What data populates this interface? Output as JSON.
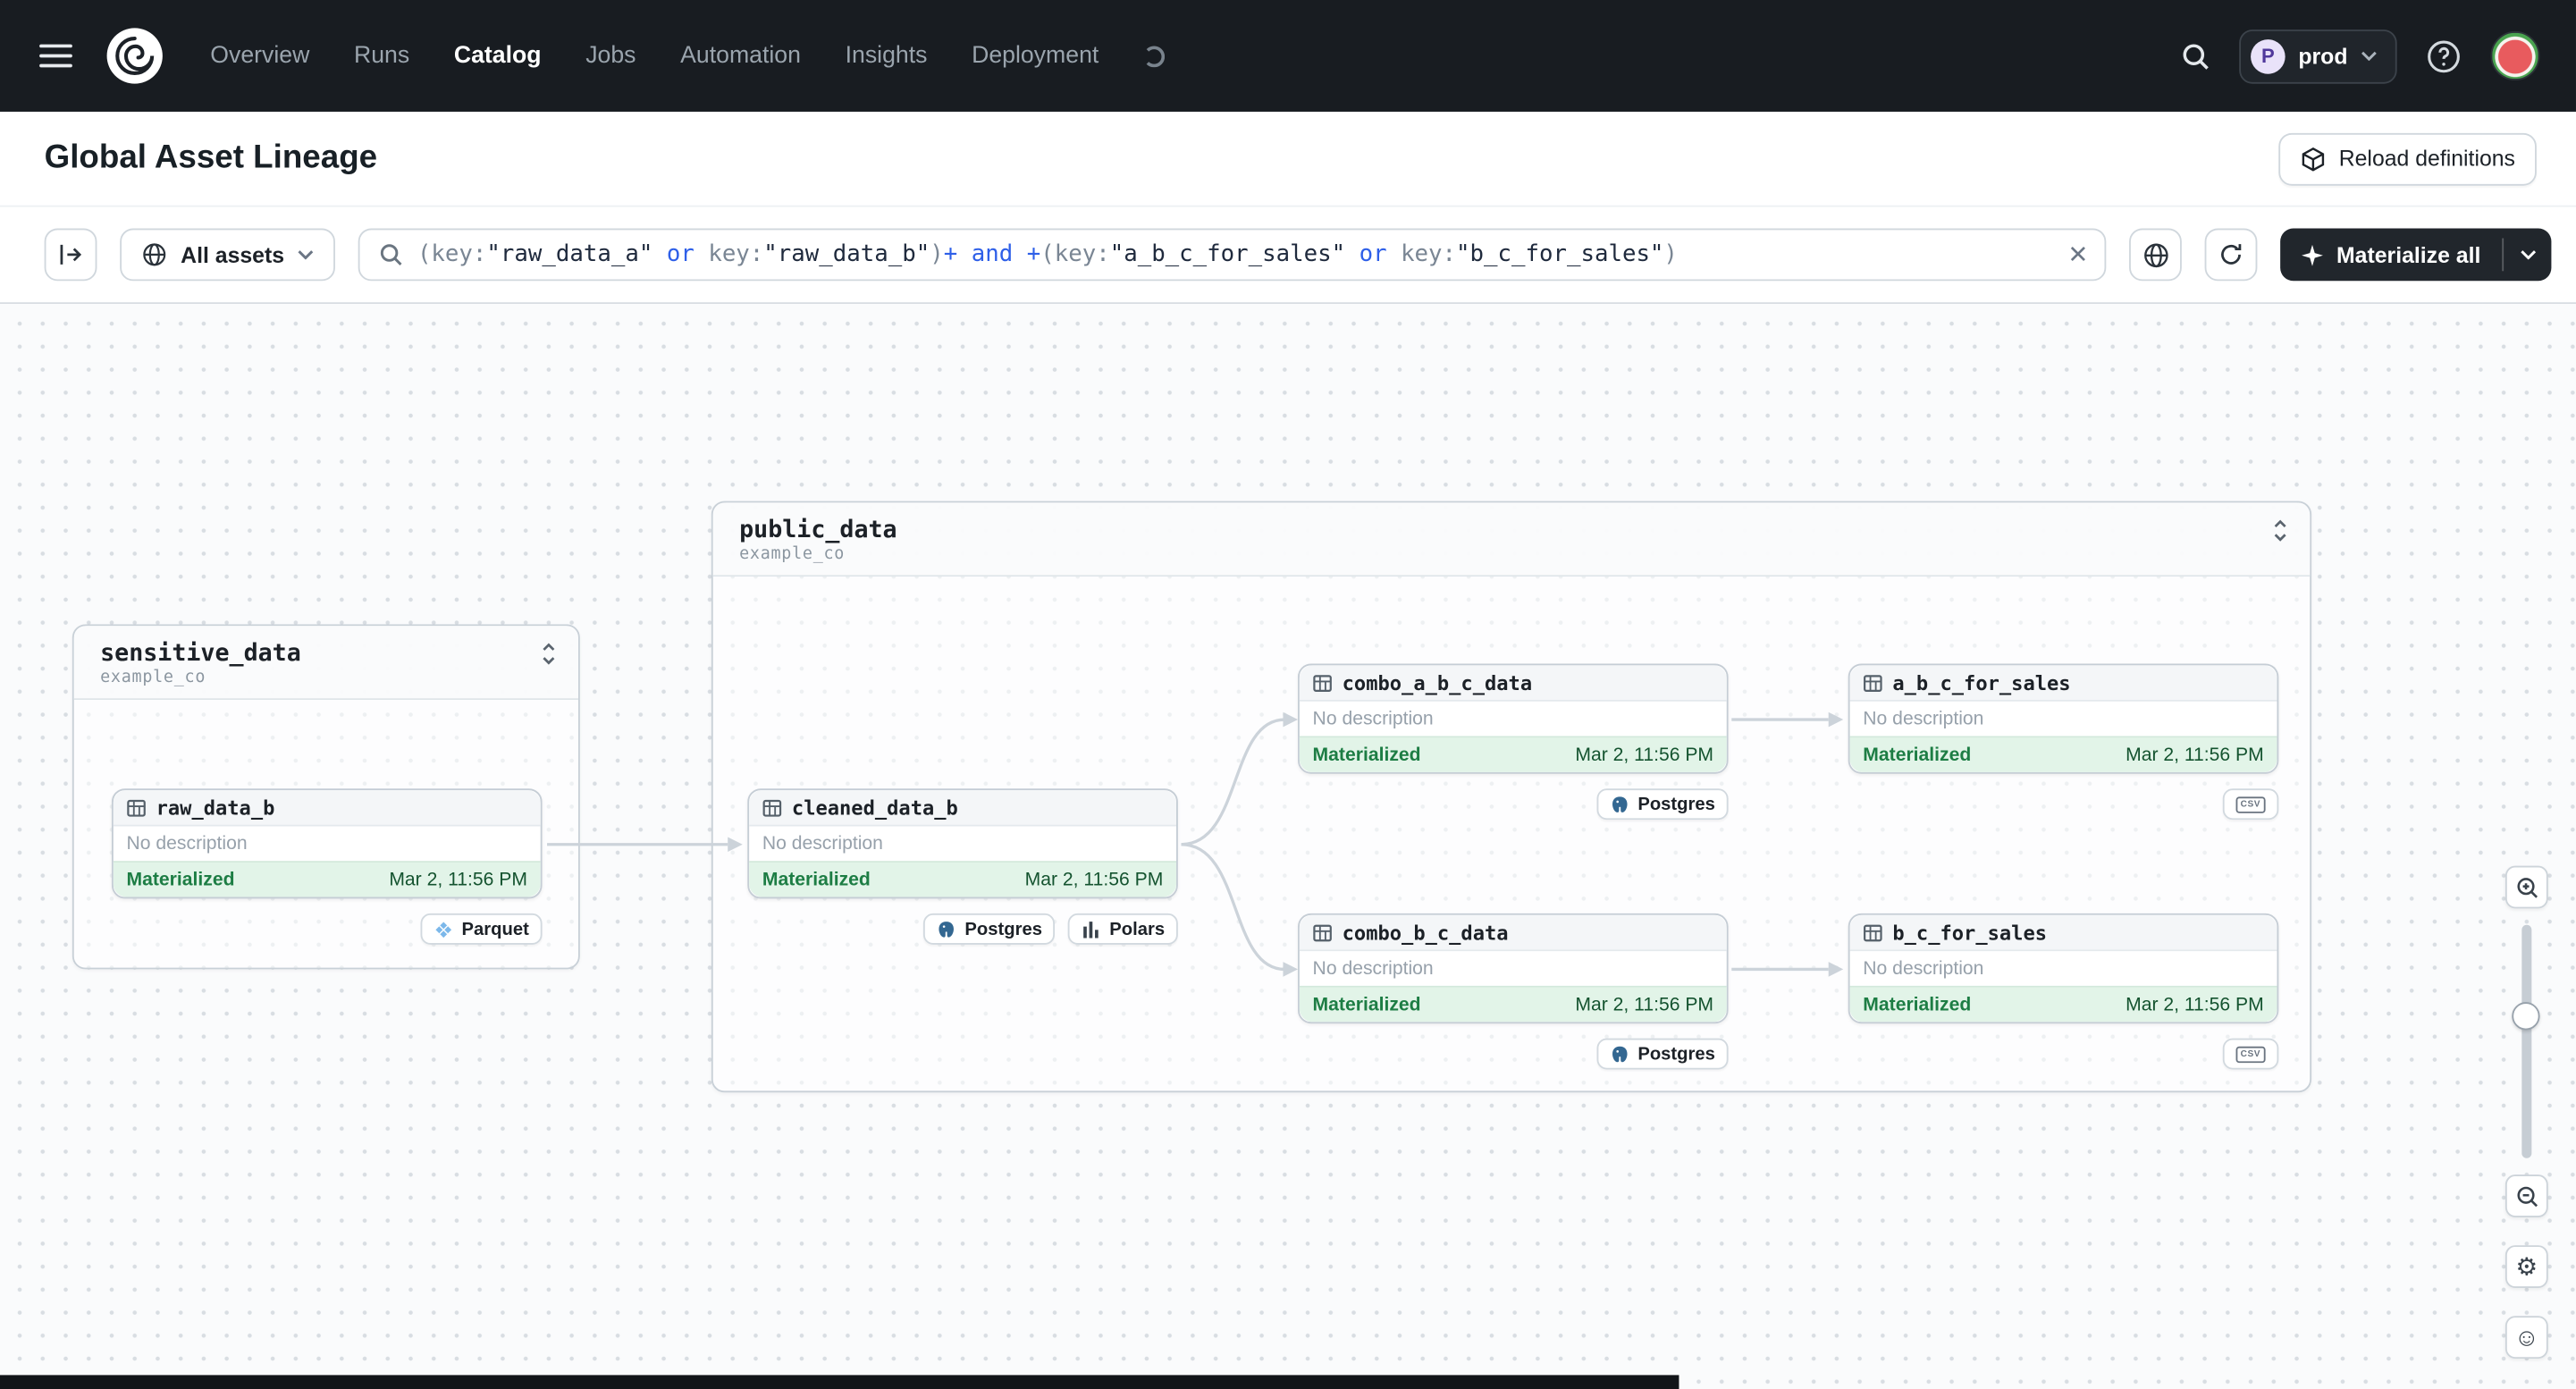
{
  "nav": {
    "items": [
      {
        "label": "Overview"
      },
      {
        "label": "Runs"
      },
      {
        "label": "Catalog"
      },
      {
        "label": "Jobs"
      },
      {
        "label": "Automation"
      },
      {
        "label": "Insights"
      },
      {
        "label": "Deployment"
      }
    ],
    "active_item": "Catalog",
    "deployment": {
      "initial": "P",
      "name": "prod"
    }
  },
  "header": {
    "title": "Global Asset Lineage",
    "reload_button": "Reload definitions"
  },
  "toolbar": {
    "scope_label": "All assets",
    "materialize_label": "Materialize all",
    "search": {
      "segments": [
        {
          "t": "(key:"
        },
        {
          "t": "\"raw_data_a\""
        },
        {
          "t": " or "
        },
        {
          "t": "key:"
        },
        {
          "t": "\"raw_data_b\""
        },
        {
          "t": ")"
        },
        {
          "t": "+"
        },
        {
          "t": " and "
        },
        {
          "t": "+"
        },
        {
          "t": "(key:"
        },
        {
          "t": "\"a_b_c_for_sales\""
        },
        {
          "t": " or "
        },
        {
          "t": "key:"
        },
        {
          "t": "\"b_c_for_sales\""
        },
        {
          "t": ")"
        }
      ]
    }
  },
  "graph": {
    "groups": [
      {
        "name": "sensitive_data",
        "repo": "example_co"
      },
      {
        "name": "public_data",
        "repo": "example_co"
      }
    ],
    "nodes": [
      {
        "name": "raw_data_b",
        "description": "No description",
        "status": "Materialized",
        "timestamp": "Mar 2, 11:56 PM",
        "tags": [
          {
            "label": "Parquet"
          }
        ]
      },
      {
        "name": "cleaned_data_b",
        "description": "No description",
        "status": "Materialized",
        "timestamp": "Mar 2, 11:56 PM",
        "tags": [
          {
            "label": "Postgres"
          },
          {
            "label": "Polars"
          }
        ]
      },
      {
        "name": "combo_a_b_c_data",
        "description": "No description",
        "status": "Materialized",
        "timestamp": "Mar 2, 11:56 PM",
        "tags": [
          {
            "label": "Postgres"
          }
        ]
      },
      {
        "name": "combo_b_c_data",
        "description": "No description",
        "status": "Materialized",
        "timestamp": "Mar 2, 11:56 PM",
        "tags": [
          {
            "label": "Postgres"
          }
        ]
      },
      {
        "name": "a_b_c_for_sales",
        "description": "No description",
        "status": "Materialized",
        "timestamp": "Mar 2, 11:56 PM",
        "tags": [
          {
            "label": "CSV"
          }
        ]
      },
      {
        "name": "b_c_for_sales",
        "description": "No description",
        "status": "Materialized",
        "timestamp": "Mar 2, 11:56 PM",
        "tags": [
          {
            "label": "CSV"
          }
        ]
      }
    ]
  },
  "icons": {
    "settings": "⚙",
    "feedback": "☺"
  },
  "colors": {
    "nav_bg": "#181c21",
    "accent_dark": "#21262c",
    "status_green": "#1d7d44",
    "status_bg": "#e2f4e8",
    "edge": "#ccd3da",
    "keyword_blue": "#2e5fe8"
  }
}
